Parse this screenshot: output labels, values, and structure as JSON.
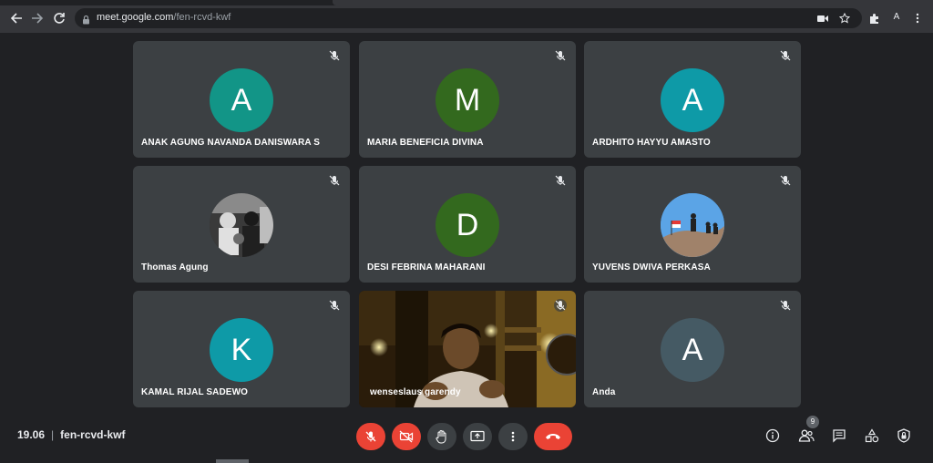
{
  "browser": {
    "url_host": "meet.google.com",
    "url_path": "/fen-rcvd-kwf",
    "profile_initial": "A"
  },
  "participants": [
    {
      "initial": "A",
      "name": "ANAK AGUNG NAVANDA DANISWARA S",
      "color": "#129587",
      "muted": true
    },
    {
      "initial": "M",
      "name": "MARIA BENEFICIA DIVINA",
      "color": "#33691e",
      "muted": true
    },
    {
      "initial": "A",
      "name": "ARDHITO HAYYU AMASTO",
      "color": "#0e9aa7",
      "muted": true
    },
    {
      "initial": "",
      "name": "Thomas Agung",
      "color": "#555555",
      "muted": true,
      "photo": "bw-photo"
    },
    {
      "initial": "D",
      "name": "DESI FEBRINA MAHARANI",
      "color": "#33691e",
      "muted": true
    },
    {
      "initial": "",
      "name": "YUVENS DWIVA PERKASA",
      "color": "#4a90d9",
      "muted": true,
      "photo": "sky-photo"
    },
    {
      "initial": "K",
      "name": "KAMAL RIJAL SADEWO",
      "color": "#0e9aa7",
      "muted": true
    },
    {
      "initial": "",
      "name": "wenseslaus garendy",
      "color": "#1a1208",
      "muted": true,
      "video": true
    },
    {
      "initial": "A",
      "name": "Anda",
      "color": "#455a64",
      "muted": true
    }
  ],
  "meeting": {
    "time": "19.06",
    "code": "fen-rcvd-kwf"
  },
  "controls": {
    "participants_count": "9"
  },
  "colors": {
    "red": "#ea4335",
    "control_bg": "#3c4043",
    "tile_bg": "#3c4043"
  }
}
